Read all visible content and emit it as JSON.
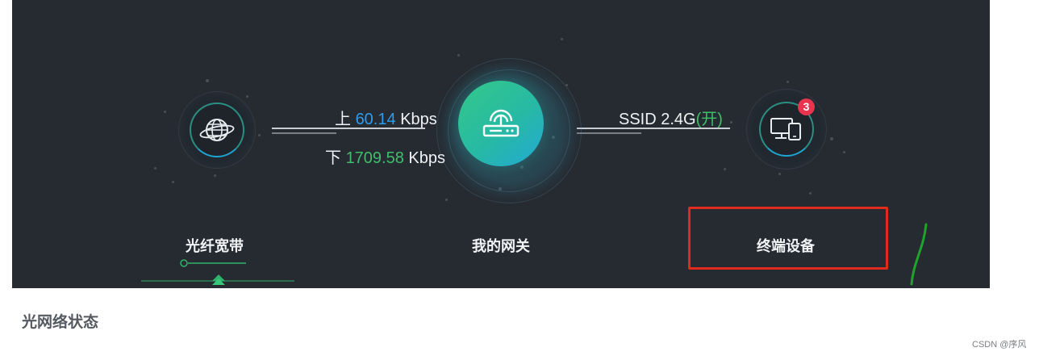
{
  "topology": {
    "upload": {
      "prefix": "上",
      "value": "60.14",
      "unit": "Kbps"
    },
    "download": {
      "prefix": "下",
      "value": "1709.58",
      "unit": "Kbps"
    },
    "ssid": {
      "label": "SSID 2.4G",
      "status": "(开)"
    },
    "terminal_count": "3",
    "nodes": [
      {
        "label": "光纤宽带",
        "icon": "globe-icon"
      },
      {
        "label": "我的网关",
        "icon": "router-icon"
      },
      {
        "label": "终端设备",
        "icon": "devices-icon"
      }
    ],
    "active_tab_index": 0
  },
  "section": {
    "title": "光网络状态"
  },
  "watermark": "CSDN @序风",
  "colors": {
    "panel_bg": "#262a31",
    "upload_value": "#2c9cf0",
    "download_value": "#3fbf6b",
    "badge": "#e8344e",
    "gateway_gradient_start": "#34c98a",
    "gateway_gradient_end": "#23a9d6",
    "annotation_box": "#e02a1c",
    "annotation_stroke": "#1fa32a"
  }
}
